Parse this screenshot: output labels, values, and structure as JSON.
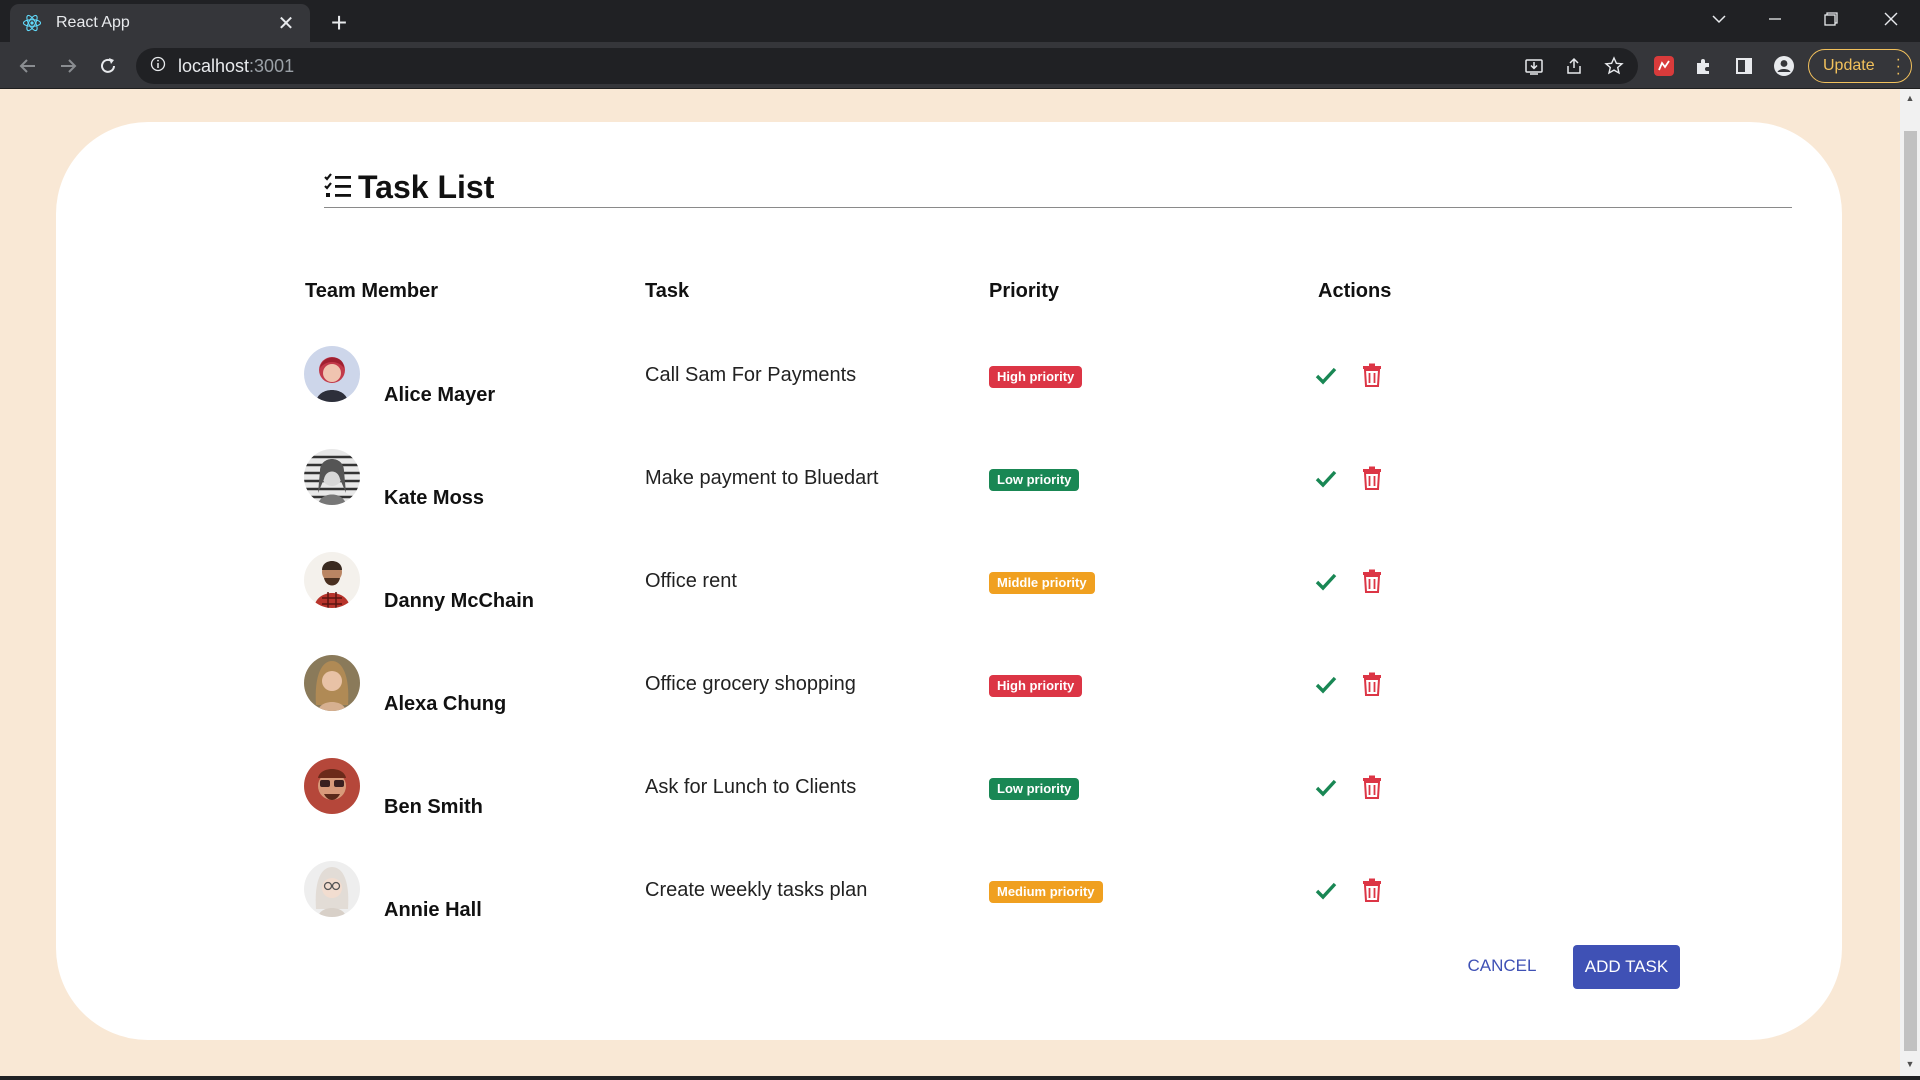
{
  "browser": {
    "tab_title": "React App",
    "url_host": "localhost",
    "url_port": ":3001",
    "update_label": "Update"
  },
  "page": {
    "title": "Task List",
    "columns": {
      "member": "Team Member",
      "task": "Task",
      "priority": "Priority",
      "actions": "Actions"
    },
    "rows": [
      {
        "name": "Alice Mayer",
        "task": "Call Sam For Payments",
        "priority": "High priority",
        "priority_level": "high"
      },
      {
        "name": "Kate Moss",
        "task": "Make payment to Bluedart",
        "priority": "Low priority",
        "priority_level": "low"
      },
      {
        "name": "Danny McChain",
        "task": "Office rent",
        "priority": "Middle priority",
        "priority_level": "middle"
      },
      {
        "name": "Alexa Chung",
        "task": "Office grocery shopping",
        "priority": "High priority",
        "priority_level": "high"
      },
      {
        "name": "Ben Smith",
        "task": "Ask for Lunch to Clients",
        "priority": "Low priority",
        "priority_level": "low"
      },
      {
        "name": "Annie Hall",
        "task": "Create weekly tasks plan",
        "priority": "Medium priority",
        "priority_level": "medium"
      }
    ],
    "buttons": {
      "cancel": "CANCEL",
      "add": "ADD TASK"
    }
  },
  "colors": {
    "page_background": "#f9e8d5",
    "card_background": "#ffffff",
    "high_priority": "#dc3545",
    "low_priority": "#198754",
    "middle_priority": "#f0a020",
    "check_icon": "#198754",
    "trash_icon": "#dc3545",
    "primary_button": "#3f51b5"
  },
  "icons": {
    "tab": "react-icon",
    "header": "task-list-icon",
    "complete": "check-icon",
    "delete": "trash-icon"
  }
}
